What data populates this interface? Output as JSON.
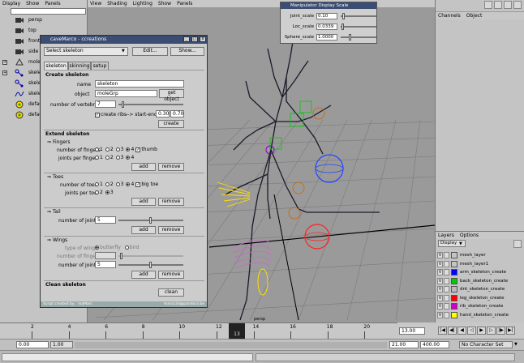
{
  "outliner": {
    "menu": [
      "Display",
      "Show",
      "Panels"
    ],
    "items": [
      {
        "label": "persp",
        "expand": false
      },
      {
        "label": "top",
        "expand": false
      },
      {
        "label": "front",
        "expand": false
      },
      {
        "label": "side",
        "expand": false
      },
      {
        "label": "moleG",
        "expand": true
      },
      {
        "label": "skele",
        "expand": true
      },
      {
        "label": "skele",
        "expand": false
      },
      {
        "label": "skele",
        "expand": false
      },
      {
        "label": "defau",
        "expand": false
      },
      {
        "label": "defau",
        "expand": false
      }
    ]
  },
  "viewport": {
    "menu": [
      "View",
      "Shading",
      "Lighting",
      "Show",
      "Panels"
    ],
    "camera_label": "persp"
  },
  "manip": {
    "title": "Manipulator Display Scale",
    "rows": [
      {
        "label": "Joint_scale",
        "value": "0.10"
      },
      {
        "label": "Loc_scale",
        "value": "0.0339"
      },
      {
        "label": "Sphere_scale",
        "value": "1.0000"
      }
    ]
  },
  "dialog": {
    "title": "caveMarco - ccreations",
    "select_value": "Select skeleton",
    "edit_label": "Edit...",
    "show_label": "Show...",
    "tabs": [
      "skeleton",
      "skinning",
      "setup"
    ],
    "create_header": "Create skeleton",
    "name_label": "name",
    "name_value": "skeleton",
    "object_label": "object",
    "object_value": "moleGrp",
    "get_object_label": "get object",
    "vertebras_label": "number of vertebras",
    "vertebras_value": "7",
    "create_ribs_label": "create ribs",
    "start_end_label": "--> start-end",
    "start_value": "0.30",
    "end_value": "0.70",
    "create_button": "create",
    "extend_header": "Extend skeleton",
    "fingers_header": "Fingers",
    "num_fingers_label": "number of fingers",
    "joints_per_finger_label": "joints per finger",
    "thumb_label": "thumb",
    "toes_header": "Toes",
    "num_toes_label": "number of toes",
    "joints_per_toe_label": "joints per toe",
    "big_toe_label": "big toe",
    "tail_header": "Tail",
    "num_joints_label": "number of joints",
    "tail_joints_value": "5",
    "wings_header": "Wings",
    "type_of_wings_label": "type of wings",
    "butterfly_label": "butterfly",
    "bird_label": "bird",
    "wing_fingers_label": "number of fingers",
    "wing_joints_label": "number of joints",
    "wing_joints_value": "5",
    "add_label": "add",
    "remove_label": "remove",
    "clean_header": "Clean skeleton",
    "clean_button": "clean",
    "status_left": "Script created by : maMarc",
    "status_right": "marco3d@pandora.be"
  },
  "channel_box": {
    "menu": [
      "Channels",
      "Object"
    ]
  },
  "layers": {
    "menu": [
      "Layers",
      "Options"
    ],
    "display_value": "Display",
    "items": [
      {
        "name": "mesh_layer",
        "color": "#c4c4c4"
      },
      {
        "name": "mesh_layer1",
        "color": "#c4c4c4"
      },
      {
        "name": "arm_skeleton_create",
        "color": "#0000ff"
      },
      {
        "name": "back_skeleton_create",
        "color": "#00cc00"
      },
      {
        "name": "dnt_skeleton_create",
        "color": "#bbbbbb"
      },
      {
        "name": "leg_skeleton_create",
        "color": "#ff0000"
      },
      {
        "name": "rib_skeleton_create",
        "color": "#cc00cc"
      },
      {
        "name": "hand_skeleton_create",
        "color": "#ffff00"
      }
    ]
  },
  "timeline": {
    "ticks": [
      "2",
      "4",
      "6",
      "8",
      "10",
      "12",
      "14",
      "16",
      "18",
      "20"
    ],
    "current_frame": "13",
    "frame_field": "13.00"
  },
  "range": {
    "start": "0.00",
    "anim_start": "1.00",
    "end": "21.00",
    "anim_end": "400.00",
    "character_set": "No Character Set"
  }
}
